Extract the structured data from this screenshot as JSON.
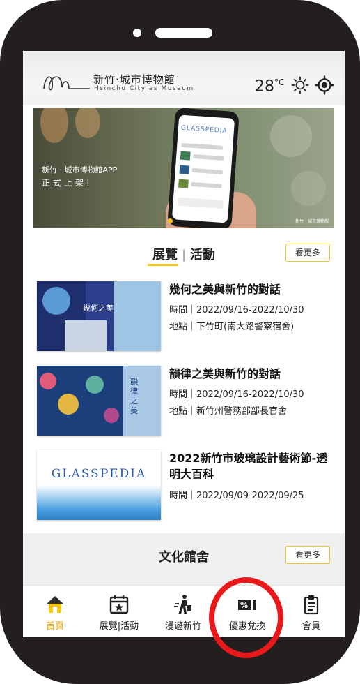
{
  "header": {
    "logo_title": "新竹·城市博物館",
    "logo_subtitle": "Hsinchu City as Museum",
    "temperature": "28",
    "temperature_unit": "°C",
    "weather_icon": "sun-icon",
    "location_icon": "locate-icon"
  },
  "banner": {
    "line1": "新竹 · 城市博物館APP",
    "line2": "正式上架!",
    "phone_title": "GLASSPEDIA",
    "credit": "新竹 · 城市博物館"
  },
  "events_section": {
    "tab_active": "展覽",
    "tab_other": "活動",
    "separator": "|",
    "more_label": "看更多"
  },
  "events": [
    {
      "title": "幾何之美與新竹的對話",
      "time": "時間｜2022/09/16-2022/10/30",
      "place": "地點｜下竹町(南大路警察宿舍)",
      "thumb_text": "幾何之美"
    },
    {
      "title": "韻律之美與新竹的對話",
      "time": "時間｜2022/09/16-2022/10/30",
      "place": "地點｜新竹州警務部部長官舍",
      "thumb_text": "韻律之美"
    },
    {
      "title": "2022新竹市玻璃設計藝術節-透明大百科",
      "time": "時間｜2022/09/09-2022/09/25",
      "place": "",
      "thumb_text": "GLASSPEDIA"
    }
  ],
  "culture_section": {
    "title": "文化館舍",
    "more_label": "看更多"
  },
  "nav": [
    {
      "label": "首頁",
      "icon": "home-icon",
      "active": true
    },
    {
      "label": "展覽|活動",
      "icon": "calendar-star-icon",
      "active": false
    },
    {
      "label": "漫遊新竹",
      "icon": "traveler-icon",
      "active": false
    },
    {
      "label": "優惠兌換",
      "icon": "discount-icon",
      "active": false
    },
    {
      "label": "會員",
      "icon": "member-clipboard-icon",
      "active": false
    }
  ],
  "colors": {
    "accent": "#f5c518",
    "active_nav": "#e6a800",
    "highlight_ring": "#e8181b"
  }
}
